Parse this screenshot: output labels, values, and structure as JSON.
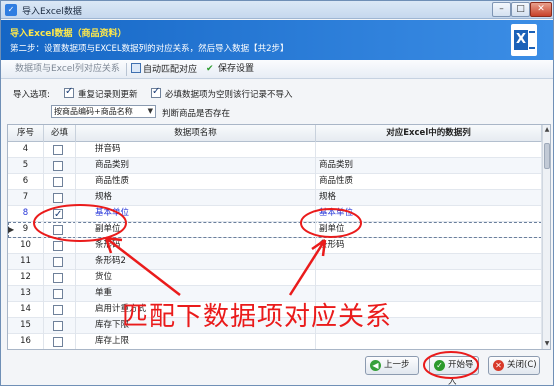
{
  "window": {
    "title": "导入Excel数据"
  },
  "banner": {
    "title": "导入Excel数据（商品资料）",
    "subtitle": "第二步：设置数据项与EXCEL数据列的对应关系，然后导入数据【共2步】"
  },
  "toolbar": {
    "tab_mapping": "数据项与Excel列对应关系",
    "auto_match": "自动匹配对应",
    "save_settings": "保存设置"
  },
  "options": {
    "label": "导入选项:",
    "overwrite_duplicates": {
      "label": "重复记录则更新",
      "checked": true
    },
    "skip_empty_required": {
      "label": "必填数据项为空则该行记录不导入",
      "checked": true
    },
    "duplicate_key_select": "按商品编码+商品名称",
    "duplicate_key_hint": "判断商品是否存在"
  },
  "grid": {
    "headers": {
      "no": "序号",
      "required": "必填",
      "name": "数据项名称",
      "mapped": "对应Excel中的数据列"
    },
    "rows": [
      {
        "no": "4",
        "required": false,
        "name": "拼音码",
        "mapped": ""
      },
      {
        "no": "5",
        "required": false,
        "name": "商品类别",
        "mapped": "商品类别"
      },
      {
        "no": "6",
        "required": false,
        "name": "商品性质",
        "mapped": "商品性质"
      },
      {
        "no": "7",
        "required": false,
        "name": "规格",
        "mapped": "规格"
      },
      {
        "no": "8",
        "required": true,
        "name": "基本单位",
        "mapped": "基本单位"
      },
      {
        "no": "9",
        "required": false,
        "name": "副单位",
        "mapped": "副单位"
      },
      {
        "no": "10",
        "required": false,
        "name": "条形码",
        "mapped": "条形码"
      },
      {
        "no": "11",
        "required": false,
        "name": "条形码2",
        "mapped": ""
      },
      {
        "no": "12",
        "required": false,
        "name": "货位",
        "mapped": ""
      },
      {
        "no": "13",
        "required": false,
        "name": "单重",
        "mapped": ""
      },
      {
        "no": "14",
        "required": false,
        "name": "启用计重方式",
        "mapped": ""
      },
      {
        "no": "15",
        "required": false,
        "name": "库存下限",
        "mapped": ""
      },
      {
        "no": "16",
        "required": false,
        "name": "库存上限",
        "mapped": ""
      },
      {
        "no": "17",
        "required": false,
        "name": "启用批号管理",
        "mapped": ""
      }
    ]
  },
  "buttons": {
    "prev": "上一步",
    "start_import": "开始导入",
    "close": "关闭(C)"
  },
  "annotation": {
    "text": "匹配下数据项对应关系",
    "color": "#ea1b1b"
  },
  "colors": {
    "banner": "#1566c5",
    "banner_title": "#ffe94a",
    "required_row": "#2434d8"
  }
}
